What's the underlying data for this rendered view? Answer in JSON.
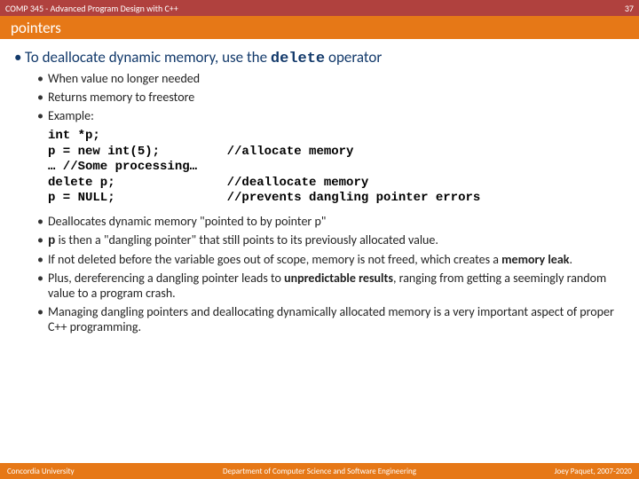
{
  "header": {
    "course": "COMP 345 - Advanced Program Design with C++",
    "page": "37",
    "title": "pointers"
  },
  "bullets": {
    "0": {
      "pre": "To deallocate dynamic memory, use the ",
      "kw": "delete",
      "post": " operator",
      "sub": {
        "0": "When value no longer needed",
        "1": "Returns memory to freestore",
        "2": "Example:"
      }
    },
    "1": "Deallocates dynamic memory \"pointed to by pointer p\"",
    "2": {
      "kw": "p",
      "post": " is then a \"dangling pointer\" that still points to its previously allocated value."
    },
    "3": {
      "pre": "If not deleted before the variable goes out of scope, memory is not freed, which creates a ",
      "kw": "memory leak",
      "post": "."
    },
    "4": {
      "pre": "Plus, dereferencing a dangling pointer leads to ",
      "kw": "unpredictable results",
      "post": ", ranging from getting a seemingly random value to a program crash."
    },
    "5": "Managing dangling pointers and deallocating dynamically allocated memory is a very important aspect of proper C++ programming."
  },
  "code": "int *p;\np = new int(5);         //allocate memory\n… //Some processing…\ndelete p;               //deallocate memory\np = NULL;               //prevents dangling pointer errors",
  "footer": {
    "left": "Concordia University",
    "center": "Department of Computer Science and Software Engineering",
    "right": "Joey Paquet, 2007-2020"
  }
}
